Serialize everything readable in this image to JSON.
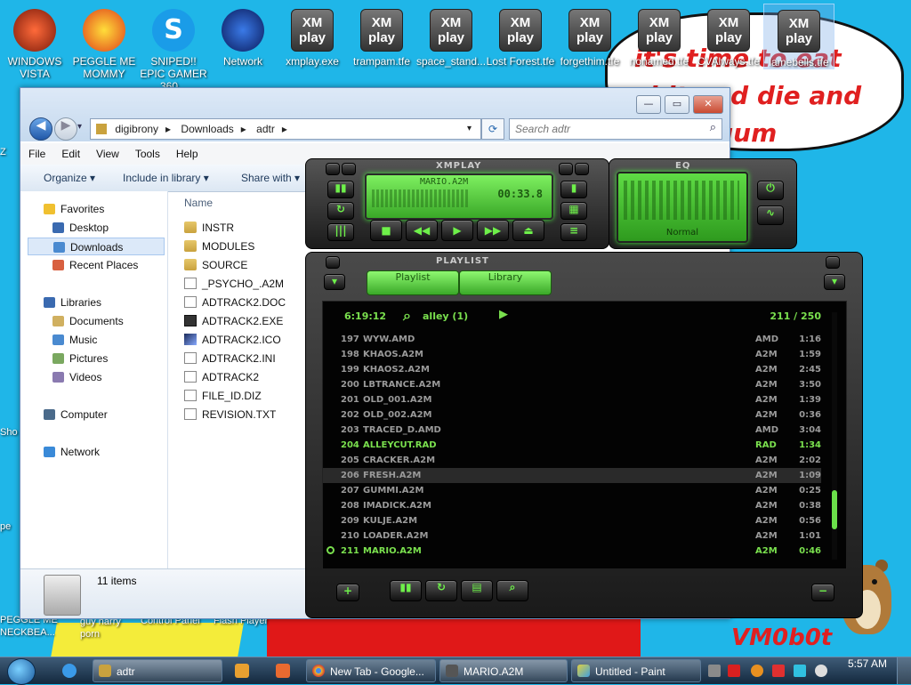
{
  "desktop": {
    "speech_bubble_text": "it's time to eat shit and die and chew gum",
    "signature": "VM0b0t",
    "icons": [
      {
        "label": "WINDOWS VISTA",
        "icon": "windows-vista-icon"
      },
      {
        "label": "PEGGLE ME MOMMY",
        "icon": "peggle-icon"
      },
      {
        "label": "SNIPED!! EPIC GAMER 360...",
        "icon": "skype-icon"
      },
      {
        "label": "Network",
        "icon": "network-icon"
      },
      {
        "label": "xmplay.exe",
        "icon": "xmplay-icon"
      },
      {
        "label": "trampam.tfe",
        "icon": "xmplay-icon"
      },
      {
        "label": "space_stand...",
        "icon": "xmplay-icon"
      },
      {
        "label": "Lost Forest.tfe",
        "icon": "xmplay-icon"
      },
      {
        "label": "forgethim.tfe",
        "icon": "xmplay-icon"
      },
      {
        "label": "nonamed.tfe",
        "icon": "xmplay-icon"
      },
      {
        "label": "CVAlways.tfe",
        "icon": "xmplay-icon"
      },
      {
        "label": "lamebells.tfe",
        "icon": "xmplay-icon"
      }
    ],
    "xm_icon_text": "XM play",
    "left_peek": [
      "Z",
      "Sho",
      "pe",
      "PEGGLE ME NECKBEA..."
    ],
    "bottom_peek": [
      "guy harry porn",
      "Control Panel",
      "Flash Player"
    ]
  },
  "explorer": {
    "breadcrumb": [
      "digibrony",
      "Downloads",
      "adtr"
    ],
    "search_placeholder": "Search adtr",
    "menu": [
      "File",
      "Edit",
      "View",
      "Tools",
      "Help"
    ],
    "toolbar": {
      "organize": "Organize ▾",
      "include": "Include in library ▾",
      "share": "Share with ▾"
    },
    "nav": {
      "favorites": "Favorites",
      "favorites_items": [
        "Desktop",
        "Downloads",
        "Recent Places"
      ],
      "libraries": "Libraries",
      "libraries_items": [
        "Documents",
        "Music",
        "Pictures",
        "Videos"
      ],
      "computer": "Computer",
      "network": "Network"
    },
    "column_name": "Name",
    "files": [
      {
        "name": "INSTR",
        "type": "folder"
      },
      {
        "name": "MODULES",
        "type": "folder"
      },
      {
        "name": "SOURCE",
        "type": "folder"
      },
      {
        "name": "_PSYCHO_.A2M",
        "type": "file"
      },
      {
        "name": "ADTRACK2.DOC",
        "type": "file"
      },
      {
        "name": "ADTRACK2.EXE",
        "type": "exe"
      },
      {
        "name": "ADTRACK2.ICO",
        "type": "ico"
      },
      {
        "name": "ADTRACK2.INI",
        "type": "file"
      },
      {
        "name": "ADTRACK2",
        "type": "file"
      },
      {
        "name": "FILE_ID.DIZ",
        "type": "file"
      },
      {
        "name": "REVISION.TXT",
        "type": "file"
      }
    ],
    "status": "11 items"
  },
  "xmplay": {
    "title": "XMPLAY",
    "eq_title": "EQ",
    "track": "MARIO.A2M",
    "time": "00:33.8",
    "eq_preset": "Normal",
    "playlist_title": "PLAYLIST",
    "tabs": [
      "Playlist",
      "Library"
    ],
    "total_time": "6:19:12",
    "filter": "alley (1)",
    "position": "211 / 250",
    "rows": [
      {
        "num": "197",
        "name": "WYW.AMD",
        "fmt": "AMD",
        "time": "1:16"
      },
      {
        "num": "198",
        "name": "KHAOS.A2M",
        "fmt": "A2M",
        "time": "1:59"
      },
      {
        "num": "199",
        "name": "KHAOS2.A2M",
        "fmt": "A2M",
        "time": "2:45"
      },
      {
        "num": "200",
        "name": "LBTRANCE.A2M",
        "fmt": "A2M",
        "time": "3:50"
      },
      {
        "num": "201",
        "name": "OLD_001.A2M",
        "fmt": "A2M",
        "time": "1:39"
      },
      {
        "num": "202",
        "name": "OLD_002.A2M",
        "fmt": "A2M",
        "time": "0:36"
      },
      {
        "num": "203",
        "name": "TRACED_D.AMD",
        "fmt": "AMD",
        "time": "3:04"
      },
      {
        "num": "204",
        "name": "ALLEYCUT.RAD",
        "fmt": "RAD",
        "time": "1:34"
      },
      {
        "num": "205",
        "name": "CRACKER.A2M",
        "fmt": "A2M",
        "time": "2:02"
      },
      {
        "num": "206",
        "name": "FRESH.A2M",
        "fmt": "A2M",
        "time": "1:09"
      },
      {
        "num": "207",
        "name": "GUMMI.A2M",
        "fmt": "A2M",
        "time": "0:25"
      },
      {
        "num": "208",
        "name": "IMADICK.A2M",
        "fmt": "A2M",
        "time": "0:38"
      },
      {
        "num": "209",
        "name": "KULJE.A2M",
        "fmt": "A2M",
        "time": "0:56"
      },
      {
        "num": "210",
        "name": "LOADER.A2M",
        "fmt": "A2M",
        "time": "1:01"
      },
      {
        "num": "211",
        "name": "MARIO.A2M",
        "fmt": "A2M",
        "time": "0:46"
      }
    ]
  },
  "taskbar": {
    "buttons": [
      {
        "label": "adtr",
        "icon": "explorer-folder-icon"
      },
      {
        "label": "New Tab - Google...",
        "icon": "chrome-icon"
      },
      {
        "label": "MARIO.A2M",
        "icon": "xmplay-icon"
      },
      {
        "label": "Untitled - Paint",
        "icon": "paint-icon"
      }
    ],
    "clock": "5:57 AM"
  },
  "colors": {
    "desktop": "#1fb6e8",
    "xm_green": "#7ae04e",
    "accent_red": "#e02020"
  }
}
